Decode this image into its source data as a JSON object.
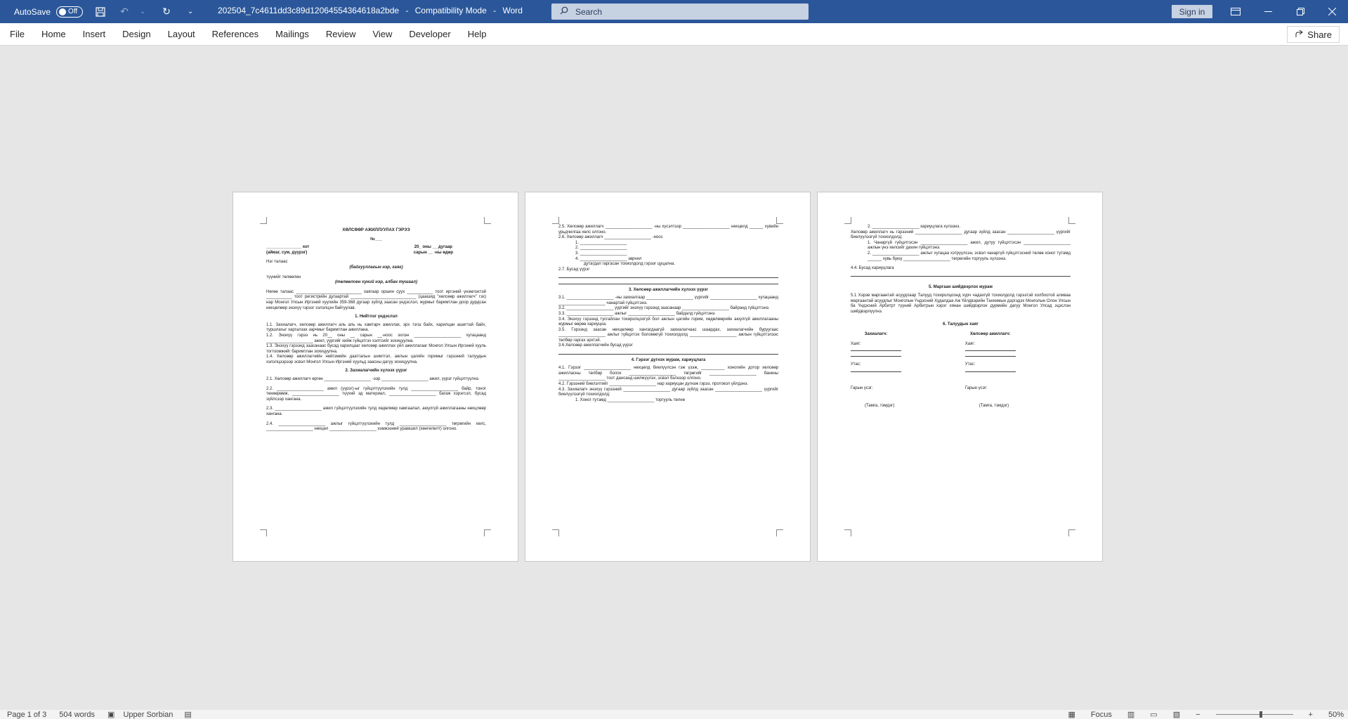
{
  "titlebar": {
    "autosave_label": "AutoSave",
    "autosave_state": "Off",
    "document_name": "202504_7c4611dd3c89d12064554364618a2bde",
    "separator1": "-",
    "mode": "Compatibility Mode",
    "separator2": "-",
    "app_name": "Word",
    "search_placeholder": "Search",
    "signin_label": "Sign in"
  },
  "ribbon": {
    "tabs": [
      "File",
      "Home",
      "Insert",
      "Design",
      "Layout",
      "References",
      "Mailings",
      "Review",
      "View",
      "Developer",
      "Help"
    ],
    "share_label": "Share"
  },
  "page1": {
    "title": "ХӨЛСӨӨР АЖИЛЛУУЛАХ ГЭРЭЭ",
    "number": "№___",
    "city_line": "_______________ хот",
    "city_sub": "(аймаг, сум, дүүрэг)",
    "date_line": "20_ оны __ дугаар",
    "date_sub": "сарын __ -ны өдөр",
    "party1": "Нэг талаас",
    "party1_sub": "(байгууллагын нэр, хаяг)",
    "rep": "түүнийг төлөөлөн",
    "rep_sub": "(төлөөлсөн хүний нэр, албан тушаал)",
    "intro": "Нөгөө талаас ____________________________ хаягаар оршин суух ___________ тоот иргэний үнэмлэхтэй ___________ тоот регистрийн дугаартай ____________________________ (цаашид \"хөлсөөр ажиллагч\" гэх) нар Монгол Улсын Иргэний хуулийн 359-368 дугаар зүйлд заасан үндэслэл, журмыг баримтлан доор дурдсан нөхцөлөөр энэхүү гэрээг хэлэлцэн байгуулав.",
    "s1_title": "1. Нийтлэг үндэслэл",
    "s1_1": "1.1. Захиалагч, хөлсөөр ажиллагч аль аль нь хамтарч ажиллах, эрх тэгш байх, харилцан ашигтай байх, туршлагыг харгалзах зарчмыг баримтлан ажиллана.",
    "s1_2": "1.2. Энэхүү гэрээ нь 20__ оны __ сарын __-ноос эхлэн ____________________ хугацаанд ____________________ ажил, үүргийг хийж гүйцэтгэх хэлтсийг зохицуулна.",
    "s1_3": "1.3. Энэхүү гэрээнд заасанаас бусад харилцааг хөлсөөр ажиллах үйл ажиллагааг Монгол Улсын Иргэний хууль тогтоомжийг баримтлан зохицуулна.",
    "s1_4": "1.4. Хөлсөөр ажиллагчийн нийгэмийн даатгалын шимтгэл, ажлын цагийн горимыг гэрээний талуудын хэлэлцээрээр эсвэл Монгол Улсын Иргэний хуульд заасны дагуу зохицуулна.",
    "s2_title": "2. Захиалагчийн хүлээх үүрэг",
    "s2_1": "2.1. Хөлсөөр ажиллагч өргөн ____________________ -ээр ____________________ ажил, үүрэг гүйцэтгүүлнэ.",
    "s2_2": "2.2. ____________________ ажил (үүрэг)-ыг гүйцэтгүүлэхийн тулд ____________________ байр, тоног төхөөрөмж, ____________________ түүхий эд материал, ____________________ багаж хэрэгсэл, бусад зүйлсээр хангана.",
    "s2_3": "2.3. ____________________ ажил гүйцэтгүүлэхийн тулд хөдөлмөр хамгаалал, аюулгүй ажиллагааны нөхцлөөр хангана.",
    "s2_4": "2.4. ____________________ ажлыг гүйцэтгүүлэхийн тулд ____________________ төгрөгийн хөлс, ____________________ нөхцөл ____________________ хэмжээний урамшил (хөнгөлөлт) олгоно."
  },
  "page2": {
    "s2_5": "2.5. Хөлсөөр ажиллагч ____________________ -ны хүсэлтээр ____________________ нөхцөлд ______ хувийн урьдчилгаа хөлс олгоно.",
    "s2_6": "2.6. Хөлсөөр ажиллагч ____________________ -ноос",
    "list": [
      "1. ____________________",
      "2. ____________________",
      "3. ____________________",
      "4. ____________________ зөрчил"
    ],
    "s2_6_end": "дутагдал гаргасан тохиолдолд гэрээг цуцална.",
    "s2_7": "2.7. Бусад үүрэг",
    "s3_title": "3. Хөлсөөр ажиллагчийн хүлээх үүрэг",
    "s3_1": "3.1. ____________________ -ны захиалгаар ____________________ үүргийг ____________________ хугацаанд ____________________ чанартай гүйцэтгэнэ.",
    "s3_2": "3.2. ____________________ үүргийг энэхүү гэрээнд заасанаар ____________________ байранд гүйцэтгэнэ.",
    "s3_3": "3.3. ____________________ ажлыг ____________________ байдалд гүйцэтгэнэ.",
    "s3_4": "3.4. Энэхүү гэрээнд тусгайлан тохиролцоогүй бол ажлын цагийн горим, хөдөлмөрийн аюулгүй ажиллагааны журмыг өөрөө хариуцна.",
    "s3_5": "3.5. Гэрээнд заасан нөхцөлөөр хангагдаагүй захиалагчаас шаардах, захиалагчийн буруугаас ____________________ ажлыг гүйцэтгэх боломжгүй тохиолдолд ____________________ ажлын гүйцэтгэлээс төлбөр гаргах эрхтэй.",
    "s3_6": "3.6.Хөлсөөр ажиллагчийн бусад үүрэг",
    "s4_title": "4. Гэрээг дүгнэх журам, хариуцлага",
    "s4_1": "4.1. Гэрээг ____________________ нөхцөлд биелүүлсэн гэж үзэж, __________ хоногийн дотор хөлсөөр ажилласны төлбөр болох ____________________ төгрөгийг ____________________ банкны ____________________ тоот дансанд шилжүүлэх, эсвэл бэлнээр олгоно.",
    "s4_2": "4.2. Гэрээний биелэлтийг ____________________ нар хариуцан дүгнэж гэрээ, протокол үйлдэнэ.",
    "s4_3": "4.3. Захиалагч энэхүү гэрээний ____________________ дугаар зүйлд заасан ____________________ үүргийг биелүүлээгүй тохиолдолд:",
    "s4_3_1": "1. Хоног тутамд ____________________ торгууль төлнө"
  },
  "page3": {
    "s4_3_2": "2. ____________________ хариуцлага хүлээнэ.",
    "s4_4a": "Хөлсөөр ажиллагч нь гэрээний ____________________ дугаар зүйлд заасан ____________________ үүргийг биелүүлээгүй тохиолдолд:",
    "s4_4_1": "1. Чанаргүй гүйцэтгэсэн ____________________ ажил, дутуу гүйцэтгэсэн ____________________ ажлын үнэ хөлсийг дахин гүйцэтгэнэ.",
    "s4_4_2": "2. ____________________ ажлыг хугацаа хэтрүүлсэн, эсвэл чанаргүй гүйцэтгэсний төлөө хоног тутамд ______ хувь буюу ____________________ төгрөгийн торгууль хүлээнэ.",
    "s4_4": "4.4. Бусад хариуцлага",
    "s5_title": "5. Маргаан шийдвэрлэх журам",
    "s5_1": "5.1 Хэрэв маргаантай асуудлаар Талууд тохиролцоонд хүрч чадахгүй тохиолдолд гэрээтэй холбоотой аливаа маргаантай асуудлыг Монголын Үндэсний Худалдаа Аж Үйлдвэрийн Танхимын дэргэдэх Монголын Олон Улсын ба Үндэсний Арбитрт түүний Арбитрын хэрэг хянан шийдвэрлэх дүрмийн дагуу Монгол Улсад эцэслэн шийдвэрлүүлнэ.",
    "s6_title": "6. Талуудын хаяг",
    "client": "Захиалагч:",
    "worker": "Хөлсөөр ажиллагч:",
    "address": "Хаяг:",
    "phone": "Утас:",
    "signature": "Гарын үсэг:",
    "stamp": "(Тамга, тэмдэг)"
  },
  "status": {
    "page": "Page 1 of 3",
    "words": "504 words",
    "language": "Upper Sorbian",
    "focus": "Focus",
    "zoom": "50%"
  }
}
